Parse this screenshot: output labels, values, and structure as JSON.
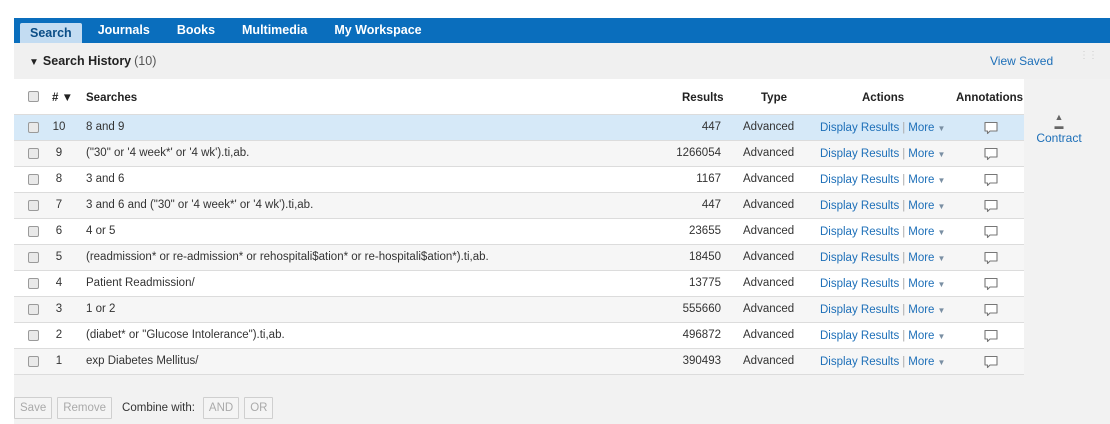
{
  "nav": {
    "tabs": [
      {
        "label": "Search",
        "active": true
      },
      {
        "label": "Journals"
      },
      {
        "label": "Books"
      },
      {
        "label": "Multimedia"
      },
      {
        "label": "My Workspace"
      }
    ]
  },
  "history": {
    "title": "Search History",
    "count": "(10)",
    "view_saved": "View Saved"
  },
  "table": {
    "headers": {
      "num": "#",
      "searches": "Searches",
      "results": "Results",
      "type": "Type",
      "actions": "Actions",
      "annotations": "Annotations"
    },
    "rows": [
      {
        "num": "10",
        "search": "8 and 9",
        "results": "447",
        "type": "Advanced"
      },
      {
        "num": "9",
        "search": "(\"30\" or '4 week*' or '4 wk').ti,ab.",
        "results": "1266054",
        "type": "Advanced"
      },
      {
        "num": "8",
        "search": "3 and 6",
        "results": "1167",
        "type": "Advanced"
      },
      {
        "num": "7",
        "search": "3 and 6 and (\"30\" or '4 week*' or '4 wk').ti,ab.",
        "results": "447",
        "type": "Advanced"
      },
      {
        "num": "6",
        "search": "4 or 5",
        "results": "23655",
        "type": "Advanced"
      },
      {
        "num": "5",
        "search": "(readmission* or re-admission* or rehospitali$ation* or re-hospitali$ation*).ti,ab.",
        "results": "18450",
        "type": "Advanced"
      },
      {
        "num": "4",
        "search": "Patient Readmission/",
        "results": "13775",
        "type": "Advanced"
      },
      {
        "num": "3",
        "search": "1 or 2",
        "results": "555660",
        "type": "Advanced"
      },
      {
        "num": "2",
        "search": "(diabet* or \"Glucose Intolerance\").ti,ab.",
        "results": "496872",
        "type": "Advanced"
      },
      {
        "num": "1",
        "search": "exp Diabetes Mellitus/",
        "results": "390493",
        "type": "Advanced"
      }
    ],
    "action_display": "Display Results",
    "action_more": "More",
    "contract": "Contract"
  },
  "footer": {
    "save": "Save",
    "remove": "Remove",
    "combine_label": "Combine with:",
    "and": "AND",
    "or": "OR"
  },
  "colors": {
    "nav_bg": "#0a6ebd",
    "link": "#1d6fb8",
    "selected_row": "#d6e9f8"
  }
}
